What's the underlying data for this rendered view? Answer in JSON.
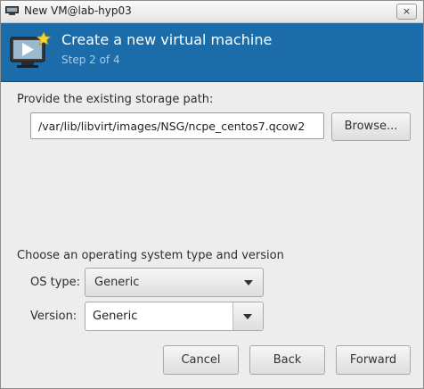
{
  "window": {
    "title": "New VM@lab-hyp03",
    "close_glyph": "×"
  },
  "header": {
    "title": "Create a new virtual machine",
    "step": "Step 2 of 4",
    "bg_color": "#1b6ca8"
  },
  "storage": {
    "label": "Provide the existing storage path:",
    "path_value": "/var/lib/libvirt/images/NSG/ncpe_centos7.qcow2",
    "browse_label": "Browse..."
  },
  "os": {
    "section_label": "Choose an operating system type and version",
    "type_label": "OS type:",
    "type_value": "Generic",
    "version_label": "Version:",
    "version_value": "Generic"
  },
  "footer": {
    "cancel_label": "Cancel",
    "back_label": "Back",
    "forward_label": "Forward"
  },
  "icons": [
    "app-monitor-icon",
    "vm-monitor-star-icon",
    "dropdown-arrow-icon"
  ]
}
